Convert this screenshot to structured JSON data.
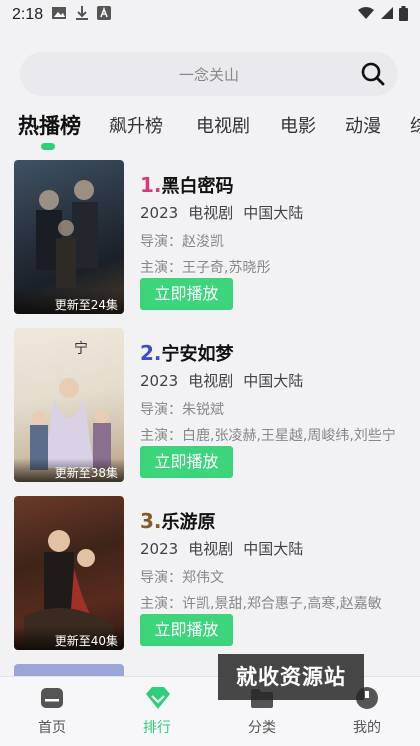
{
  "status_bar": {
    "time": "2:18"
  },
  "search": {
    "placeholder": "一念关山"
  },
  "tabs": [
    {
      "label": "热播榜"
    },
    {
      "label": "飙升榜"
    },
    {
      "label": "电视剧"
    },
    {
      "label": "电影"
    },
    {
      "label": "动漫"
    },
    {
      "label": "综"
    }
  ],
  "items": [
    {
      "rank": "1.",
      "rank_color": "#e0357a",
      "title": "黑白密码",
      "year": "2023",
      "type": "电视剧",
      "region": "中国大陆",
      "director": "导演：赵浚凯",
      "cast": "主演：王子奇,苏晓彤",
      "badge": "更新至24集",
      "play_label": "立即播放"
    },
    {
      "rank": "2.",
      "rank_color": "#3b4bd6",
      "title": "宁安如梦",
      "year": "2023",
      "type": "电视剧",
      "region": "中国大陆",
      "director": "导演：朱锐斌",
      "cast": "主演：白鹿,张凌赫,王星越,周峻纬,刘些宁",
      "badge": "更新至38集",
      "play_label": "立即播放"
    },
    {
      "rank": "3.",
      "rank_color": "#8a5a2b",
      "title": "乐游原",
      "year": "2023",
      "type": "电视剧",
      "region": "中国大陆",
      "director": "导演：郑伟文",
      "cast": "主演：许凯,景甜,郑合惠子,高寒,赵嘉敏",
      "badge": "更新至40集",
      "play_label": "立即播放"
    }
  ],
  "watermark": "就收资源站",
  "bottom_nav": [
    {
      "label": "首页"
    },
    {
      "label": "排行"
    },
    {
      "label": "分类"
    },
    {
      "label": "我的"
    }
  ],
  "colors": {
    "accent": "#3dd57c",
    "active_tab_indicator": "#2fcf7a"
  }
}
